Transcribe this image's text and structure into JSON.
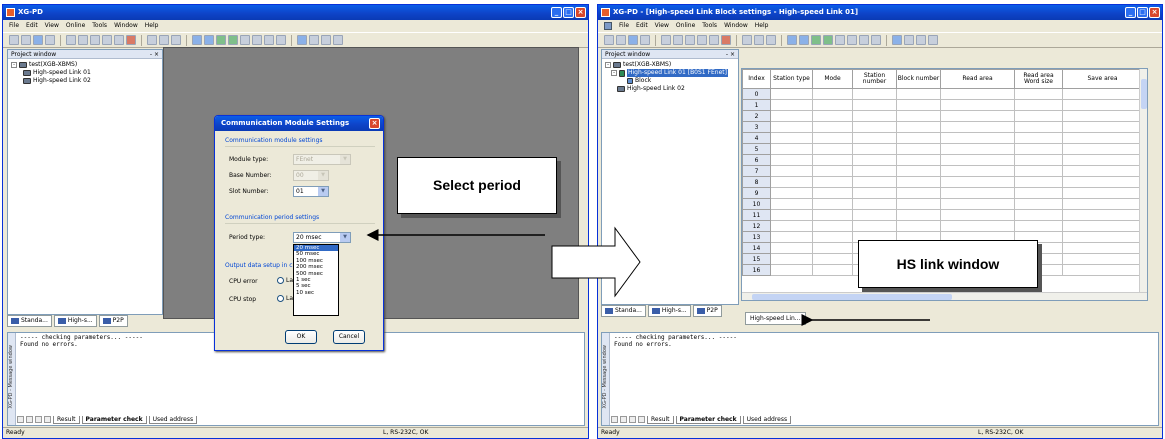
{
  "left": {
    "title": "XG-PD",
    "menus": [
      "File",
      "Edit",
      "View",
      "Online",
      "Tools",
      "Window",
      "Help"
    ],
    "project_window_title": "Project window",
    "tree": {
      "root": "test(XGB-XBMS)",
      "children": [
        "High-speed Link 01",
        "High-speed Link 02"
      ]
    },
    "view_tabs": [
      "Standa...",
      "High-s...",
      "P2P"
    ],
    "dialog": {
      "title": "Communication Module Settings",
      "section1": "Communication module settings",
      "module_type_label": "Module type:",
      "module_type_value": "FEnet",
      "base_number_label": "Base Number:",
      "base_number_value": "00",
      "slot_number_label": "Slot Number:",
      "slot_number_value": "01",
      "section2": "Communication period settings",
      "period_type_label": "Period type:",
      "period_type_value": "20 msec",
      "period_options": [
        "20 msec",
        "50 msec",
        "100 msec",
        "200 msec",
        "500 msec",
        "1 sec",
        "5 sec",
        "10 sec"
      ],
      "section3": "Output data setup in c",
      "cpu_error_label": "CPU error",
      "cpu_stop_label": "CPU stop",
      "radio_text": "La",
      "ok_label": "OK",
      "cancel_label": "Cancel"
    },
    "messages": "----- checking parameters... -----\nFound no errors.",
    "message_window_label": "XG-PD - Message window",
    "message_tabs": [
      "Result",
      "Parameter check",
      "Used address"
    ],
    "status_ready": "Ready",
    "status_conn": "L, RS-232C, OK"
  },
  "right": {
    "title": "XG-PD - [High-speed Link Block settings - High-speed Link 01]",
    "menus": [
      "File",
      "Edit",
      "View",
      "Online",
      "Tools",
      "Window",
      "Help"
    ],
    "project_window_title": "Project window",
    "tree": {
      "root": "test(XGB-XBMS)",
      "selected": "High-speed Link 01 [B0S1 FEnet]",
      "block": "Block",
      "other": "High-speed Link 02"
    },
    "view_tabs": [
      "Standa...",
      "High-s...",
      "P2P"
    ],
    "doc_tab": "High-speed Lin...",
    "table": {
      "columns": [
        "Index",
        "Station type",
        "Mode",
        "Station number",
        "Block number",
        "Read area",
        "Read area Word size",
        "Save area"
      ],
      "rows": [
        "0",
        "1",
        "2",
        "3",
        "4",
        "5",
        "6",
        "7",
        "8",
        "9",
        "10",
        "11",
        "12",
        "13",
        "14",
        "15",
        "16"
      ]
    },
    "messages": "----- checking parameters... -----\nFound no errors.",
    "message_window_label": "XG-PD - Message window",
    "message_tabs": [
      "Result",
      "Parameter check",
      "Used address"
    ],
    "status_ready": "Ready",
    "status_conn": "L, RS-232C, OK"
  },
  "callouts": {
    "select_period": "Select period",
    "hs_link_window": "HS link window"
  }
}
